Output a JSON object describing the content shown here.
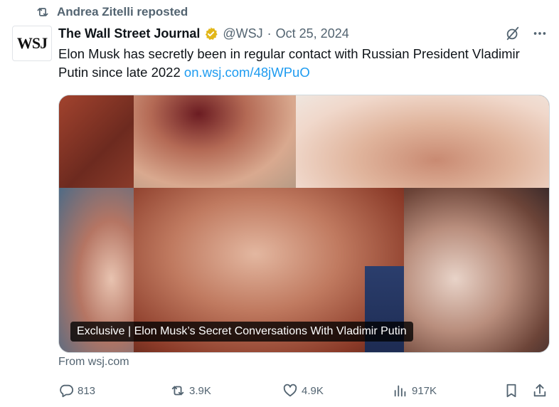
{
  "repost": {
    "text": "Andrea Zitelli reposted",
    "icon": "repost-icon"
  },
  "author": {
    "avatar_text": "WSJ",
    "name": "The Wall Street Journal",
    "handle": "@WSJ",
    "separator": "·",
    "date": "Oct 25, 2024",
    "verified_color": "#e2b719"
  },
  "tweet": {
    "text": "Elon Musk has secretly been in regular contact with Russian President Vladimir Putin since late 2022 ",
    "link": "on.wsj.com/48jWPuO"
  },
  "card": {
    "caption": "Exclusive | Elon Musk’s Secret Conversations With Vladimir Putin",
    "source": "From wsj.com"
  },
  "actions": {
    "replies": "813",
    "reposts": "3.9K",
    "likes": "4.9K",
    "views": "917K"
  },
  "colors": {
    "text": "#0f1419",
    "muted": "#536471",
    "link": "#1d9bf0"
  }
}
